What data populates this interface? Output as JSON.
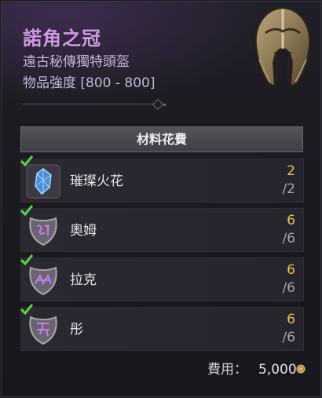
{
  "item": {
    "name": "諾角之冠",
    "type": "遠古秘傳獨特頭盔",
    "strength": "物品強度 [800 - 800]",
    "icon": "helmet-icon"
  },
  "materials": {
    "header": "材料花費",
    "rows": [
      {
        "label": "璀璨火花",
        "have": "2",
        "need": "/2",
        "icon": "spark-gem-icon"
      },
      {
        "label": "奧姆",
        "have": "6",
        "need": "/6",
        "icon": "rune-om-icon"
      },
      {
        "label": "拉克",
        "have": "6",
        "need": "/6",
        "icon": "rune-lac-icon"
      },
      {
        "label": "彤",
        "have": "6",
        "need": "/6",
        "icon": "rune-tong-icon"
      }
    ]
  },
  "cost": {
    "label": "費用：",
    "value": "5,000",
    "icon": "gold-coin-icon"
  },
  "colors": {
    "title": "#cf9be0",
    "have_count": "#e8c04a",
    "check": "#5bd14a"
  }
}
